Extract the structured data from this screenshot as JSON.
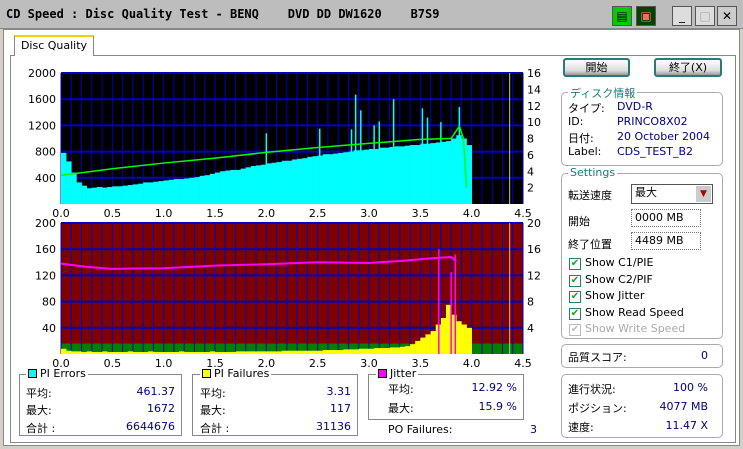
{
  "window": {
    "title": "CD Speed : Disc Quality Test - BENQ    DVD DD DW1620    B7S9",
    "icons": [
      "copy-icon",
      "save-icon",
      "minimize-icon",
      "maximize-icon",
      "close-icon"
    ]
  },
  "tabs": [
    {
      "label": "Disc Quality",
      "active": true
    }
  ],
  "buttons": {
    "start": "開始",
    "exit": "終了(X)"
  },
  "disc_info": {
    "title": "ディスク情報",
    "type_label": "タイプ:",
    "type": "DVD-R",
    "id_label": "ID:",
    "id": "PRINCO8X02",
    "date_label": "日付:",
    "date": "20 October 2004",
    "label_label": "Label:",
    "label": "CDS_TEST_B2"
  },
  "settings": {
    "title": "Settings",
    "speed_label": "転送速度",
    "speed": "最大",
    "start_label": "開始",
    "start": "0000 MB",
    "end_label": "終了位置",
    "end": "4489 MB",
    "checks": [
      {
        "label": "Show C1/PIE",
        "checked": true,
        "enabled": true
      },
      {
        "label": "Show C2/PIF",
        "checked": true,
        "enabled": true
      },
      {
        "label": "Show Jitter",
        "checked": true,
        "enabled": true
      },
      {
        "label": "Show Read Speed",
        "checked": true,
        "enabled": true
      },
      {
        "label": "Show Write Speed",
        "checked": true,
        "enabled": false
      }
    ]
  },
  "quality": {
    "label": "品質スコア:",
    "value": "0"
  },
  "progress": {
    "progress_label": "進行状況:",
    "progress": "100 %",
    "position_label": "ポジション:",
    "position": "4077 MB",
    "speed_label": "速度:",
    "speed": "11.47 X"
  },
  "stats": {
    "pi_errors": {
      "title": "PI Errors",
      "color": "#00ffff",
      "avg_label": "平均:",
      "avg": "461.37",
      "max_label": "最大:",
      "max": "1672",
      "total_label": "合計 :",
      "total": "6644676"
    },
    "pi_failures": {
      "title": "PI Failures",
      "color": "#ffff00",
      "avg_label": "平均:",
      "avg": "3.31",
      "max_label": "最大:",
      "max": "117",
      "total_label": "合計 :",
      "total": "31136"
    },
    "jitter": {
      "title": "Jitter",
      "color": "#ff00ff",
      "avg_label": "平均:",
      "avg": "12.92 %",
      "max_label": "最大:",
      "max": "15.9 %"
    },
    "po_failures": {
      "label": "PO Failures:",
      "value": "3"
    }
  },
  "chart_data": [
    {
      "type": "bar",
      "name": "pi-errors-chart",
      "xlim": [
        0,
        4.5
      ],
      "ylim": [
        0,
        2000
      ],
      "y2lim": [
        0,
        16
      ],
      "xticks": [
        "0.0",
        "0.5",
        "1.0",
        "1.5",
        "2.0",
        "2.5",
        "3.0",
        "3.5",
        "4.0",
        "4.5"
      ],
      "yticks": [
        "400",
        "800",
        "1200",
        "1600",
        "2000"
      ],
      "y2ticks": [
        "2",
        "4",
        "6",
        "8",
        "10",
        "12",
        "14",
        "16"
      ],
      "colors": {
        "background": "#000000",
        "grid": "#0000c0",
        "pi_errors": "#00ffff",
        "read_speed": "#00ff00",
        "end_marker": "#c0c0c0"
      },
      "x_step": 0.05,
      "pi_errors": [
        780,
        650,
        480,
        330,
        280,
        240,
        250,
        260,
        250,
        260,
        270,
        270,
        280,
        290,
        300,
        310,
        330,
        330,
        340,
        350,
        360,
        370,
        380,
        380,
        390,
        400,
        410,
        430,
        440,
        460,
        480,
        500,
        510,
        520,
        520,
        540,
        560,
        580,
        590,
        600,
        620,
        630,
        640,
        660,
        660,
        680,
        690,
        700,
        720,
        730,
        740,
        760,
        760,
        770,
        780,
        790,
        800,
        820,
        820,
        830,
        840,
        840,
        860,
        860,
        870,
        880,
        880,
        890,
        900,
        900,
        920,
        920,
        930,
        940,
        950,
        960,
        1000,
        1050,
        1000,
        900
      ],
      "pi_error_spikes": [
        [
          2.0,
          1080
        ],
        [
          2.52,
          1150
        ],
        [
          2.83,
          1140
        ],
        [
          2.87,
          1670
        ],
        [
          2.92,
          1430
        ],
        [
          3.05,
          1200
        ],
        [
          3.1,
          1260
        ],
        [
          3.24,
          1600
        ],
        [
          3.52,
          1460
        ],
        [
          3.57,
          1320
        ],
        [
          3.7,
          1250
        ],
        [
          3.88,
          1480
        ]
      ],
      "read_speed": [
        [
          0,
          3.5
        ],
        [
          0.5,
          4.3
        ],
        [
          1.0,
          5.0
        ],
        [
          1.5,
          5.6
        ],
        [
          2.0,
          6.3
        ],
        [
          2.5,
          6.9
        ],
        [
          3.0,
          7.4
        ],
        [
          3.5,
          7.9
        ],
        [
          3.8,
          8.0
        ],
        [
          3.88,
          9.5
        ],
        [
          3.92,
          8.0
        ],
        [
          3.95,
          2.0
        ]
      ],
      "end_marker": 4.37
    },
    {
      "type": "bar",
      "name": "pi-failures-chart",
      "xlim": [
        0,
        4.5
      ],
      "ylim": [
        0,
        200
      ],
      "y2lim": [
        0,
        20
      ],
      "xticks": [
        "0.0",
        "0.5",
        "1.0",
        "1.5",
        "2.0",
        "2.5",
        "3.0",
        "3.5",
        "4.0",
        "4.5"
      ],
      "yticks": [
        "40",
        "80",
        "120",
        "160",
        "200"
      ],
      "y2ticks": [
        "4",
        "8",
        "12",
        "16",
        "20"
      ],
      "colors": {
        "background": "#800000",
        "band": "#008000",
        "grid": "#0000c0",
        "pi_failures": "#ffff00",
        "jitter": "#ff00ff",
        "end_marker": "#c0c0c0"
      },
      "band_limit": 16,
      "x_step": 0.05,
      "pi_failures": [
        8,
        5,
        4,
        4,
        3,
        4,
        3,
        3,
        4,
        3,
        3,
        3,
        3,
        4,
        3,
        3,
        3,
        4,
        3,
        3,
        3,
        3,
        3,
        4,
        3,
        3,
        3,
        3,
        3,
        4,
        3,
        3,
        3,
        3,
        4,
        4,
        4,
        4,
        4,
        4,
        4,
        4,
        4,
        5,
        5,
        5,
        5,
        5,
        5,
        5,
        5,
        6,
        6,
        6,
        6,
        7,
        7,
        7,
        8,
        8,
        8,
        9,
        9,
        9,
        10,
        10,
        11,
        12,
        15,
        20,
        25,
        30,
        35,
        45,
        55,
        75,
        60,
        50,
        45,
        40
      ],
      "jitter": [
        [
          0,
          13.8
        ],
        [
          0.25,
          13.3
        ],
        [
          0.5,
          13.0
        ],
        [
          1.0,
          13.1
        ],
        [
          1.5,
          13.5
        ],
        [
          2.0,
          13.7
        ],
        [
          2.5,
          14.0
        ],
        [
          3.0,
          13.9
        ],
        [
          3.3,
          14.2
        ],
        [
          3.6,
          14.6
        ],
        [
          3.8,
          14.8
        ],
        [
          3.85,
          14.2
        ]
      ],
      "jitter_spikes": [
        [
          3.68,
          16.0
        ],
        [
          3.8,
          12.5
        ],
        [
          3.84,
          15.2
        ]
      ],
      "end_marker": 4.37
    }
  ]
}
